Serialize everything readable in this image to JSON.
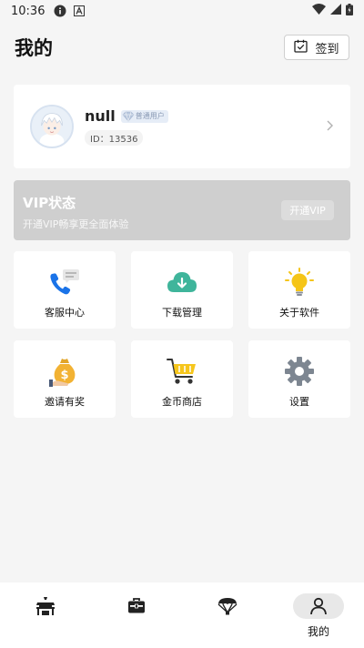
{
  "status_bar": {
    "time": "10:36",
    "info_icon": "info-icon",
    "a_icon": "a-icon",
    "wifi_icon": "wifi-icon",
    "signal_icon": "signal-icon",
    "battery_icon": "battery-icon"
  },
  "header": {
    "title": "我的",
    "signin_label": "签到",
    "signin_icon": "calendar-check-icon"
  },
  "profile": {
    "username": "null",
    "badge_label": "普通用户",
    "uid": "ID：13536",
    "avatar_icon": "avatar"
  },
  "vip": {
    "title": "VIP状态",
    "subtitle": "开通VIP畅享更全面体验",
    "button_label": "开通VIP"
  },
  "grid": [
    {
      "label": "客服中心",
      "icon": "phone-chat-icon"
    },
    {
      "label": "下载管理",
      "icon": "cloud-download-icon"
    },
    {
      "label": "关于软件",
      "icon": "lightbulb-icon"
    },
    {
      "label": "邀请有奖",
      "icon": "money-bag-icon"
    },
    {
      "label": "金币商店",
      "icon": "shopping-cart-icon"
    },
    {
      "label": "设置",
      "icon": "gear-icon"
    }
  ],
  "bottom_nav": [
    {
      "label": "",
      "icon": "stall-icon"
    },
    {
      "label": "",
      "icon": "briefcase-icon"
    },
    {
      "label": "",
      "icon": "parachute-icon"
    },
    {
      "label": "我的",
      "icon": "person-icon",
      "active": true
    }
  ],
  "colors": {
    "background": "#f5f5f5",
    "vip_bg": "#cfcfcf",
    "download_green": "#3fb59b",
    "phone_blue": "#1a73e8",
    "bulb_yellow": "#f5c518",
    "cart_yellow": "#f6c61c",
    "gear_gray": "#7d8691"
  }
}
